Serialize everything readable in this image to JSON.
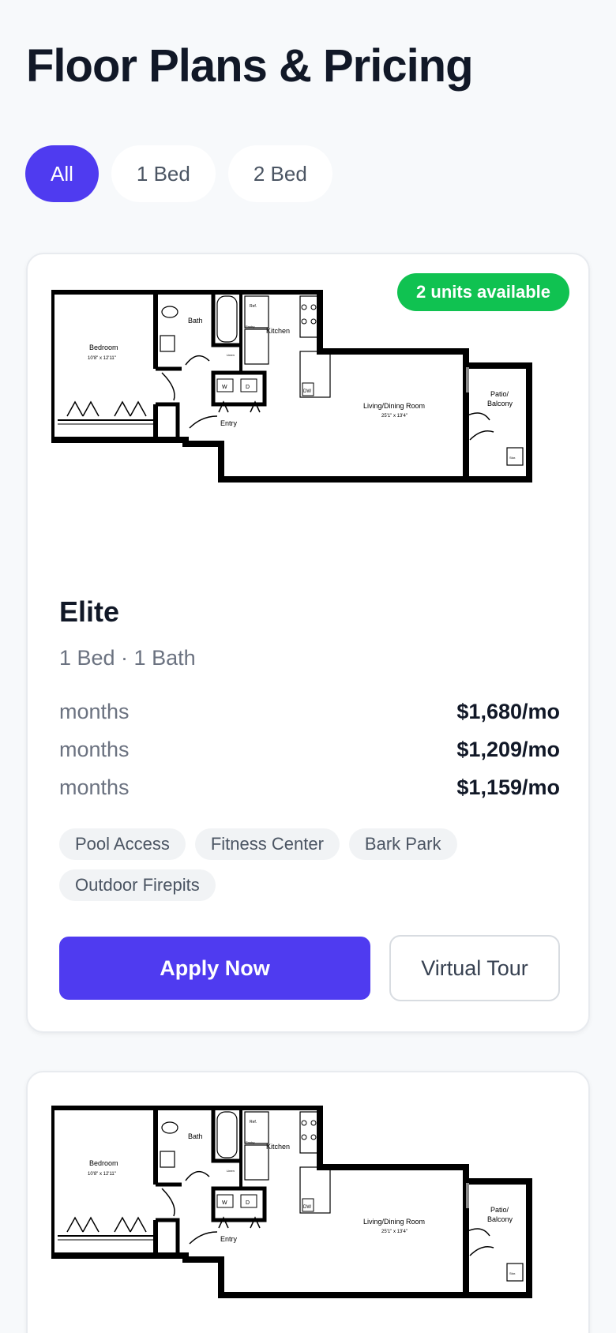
{
  "page": {
    "title": "Floor Plans & Pricing"
  },
  "filters": [
    {
      "label": "All",
      "active": true
    },
    {
      "label": "1 Bed",
      "active": false
    },
    {
      "label": "2 Bed",
      "active": false
    }
  ],
  "cards": [
    {
      "badge": "2 units available",
      "name": "Elite",
      "specs": "1 Bed · 1 Bath",
      "prices": [
        {
          "term": "months",
          "amount": "$1,680/mo"
        },
        {
          "term": "months",
          "amount": "$1,209/mo"
        },
        {
          "term": "months",
          "amount": "$1,159/mo"
        }
      ],
      "amenities": [
        "Pool Access",
        "Fitness Center",
        "Bark Park",
        "Outdoor Firepits"
      ],
      "primary_action": "Apply Now",
      "secondary_action": "Virtual Tour",
      "floorplan": {
        "labels": {
          "bedroom": "Bedroom",
          "bedroom_dims": "10'8\" x 12'11\"",
          "bath": "Bath",
          "ref": "Ref.",
          "pantry": "Pantry",
          "kitchen": "Kitchen",
          "linen": "Linen",
          "washer": "W",
          "dryer": "D",
          "dw": "DW",
          "entry": "Entry",
          "living": "Living/Dining Room",
          "living_dims": "25'1\" x 13'4\"",
          "patio": "Patio/",
          "balcony": "Balcony",
          "storage": "Stor."
        }
      }
    },
    {
      "floorplan": {
        "labels": {
          "bedroom": "Bedroom",
          "bedroom_dims": "10'8\" x 12'11\"",
          "bath": "Bath",
          "ref": "Ref.",
          "pantry": "Pantry",
          "kitchen": "Kitchen",
          "linen": "Linen",
          "washer": "W",
          "dryer": "D",
          "dw": "DW",
          "entry": "Entry",
          "living": "Living/Dining Room",
          "living_dims": "25'1\" x 13'4\"",
          "patio": "Patio/",
          "balcony": "Balcony",
          "storage": "Stor."
        }
      }
    }
  ],
  "colors": {
    "accent": "#4f3bf0",
    "available_badge": "#10c251",
    "background": "#f7f9fb"
  }
}
